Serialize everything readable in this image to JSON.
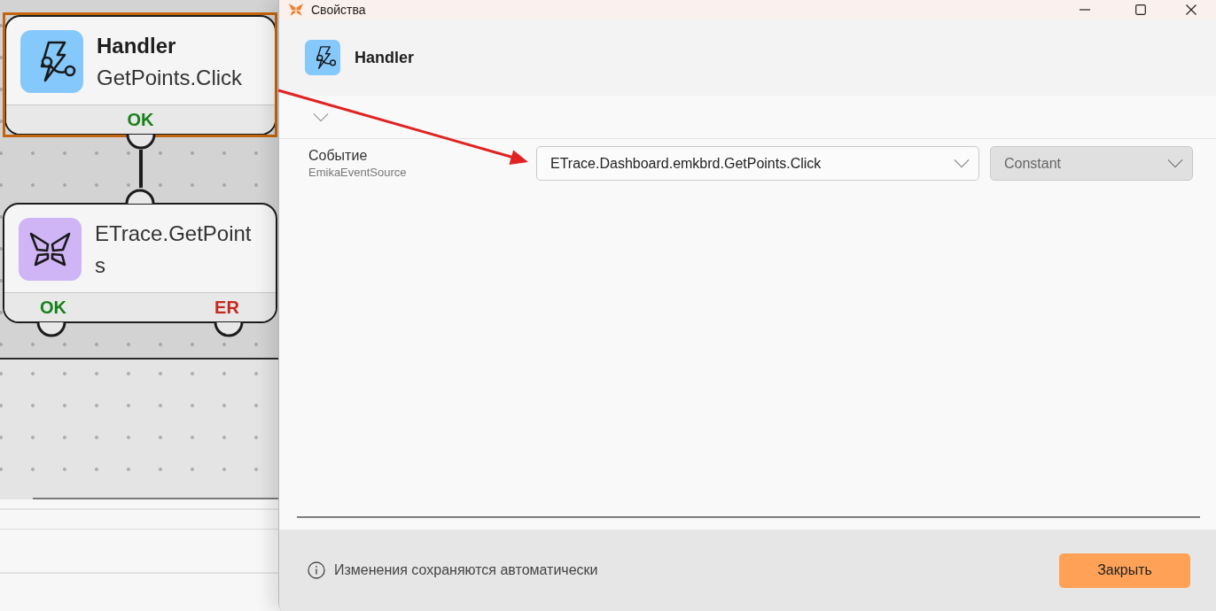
{
  "canvas": {
    "nodes": [
      {
        "kind": "handler",
        "title": "Handler",
        "caption": "GetPoints.Click",
        "selected": true,
        "has_input": false,
        "outputs": [
          {
            "label": "OK",
            "kind": "ok",
            "connected": true
          }
        ]
      },
      {
        "kind": "action",
        "caption": "ETrace.GetPoints",
        "selected": false,
        "has_input": true,
        "outputs": [
          {
            "label": "OK",
            "kind": "ok",
            "connected": false
          },
          {
            "label": "ER",
            "kind": "error",
            "connected": false
          }
        ]
      }
    ]
  },
  "dialog": {
    "title": "Свойства",
    "header": {
      "kind": "handler",
      "title": "Handler"
    },
    "expander": {
      "expanded": false
    },
    "properties": [
      {
        "label": "Событие",
        "type_name": "EmikaEventSource",
        "value": {
          "text": "ETrace.Dashboard.emkbrd.GetPoints.Click",
          "disabled": false
        },
        "mode": {
          "text": "Constant",
          "disabled": true
        }
      }
    ],
    "footer": {
      "note": "Изменения сохраняются автоматически",
      "button": "Закрыть"
    }
  }
}
